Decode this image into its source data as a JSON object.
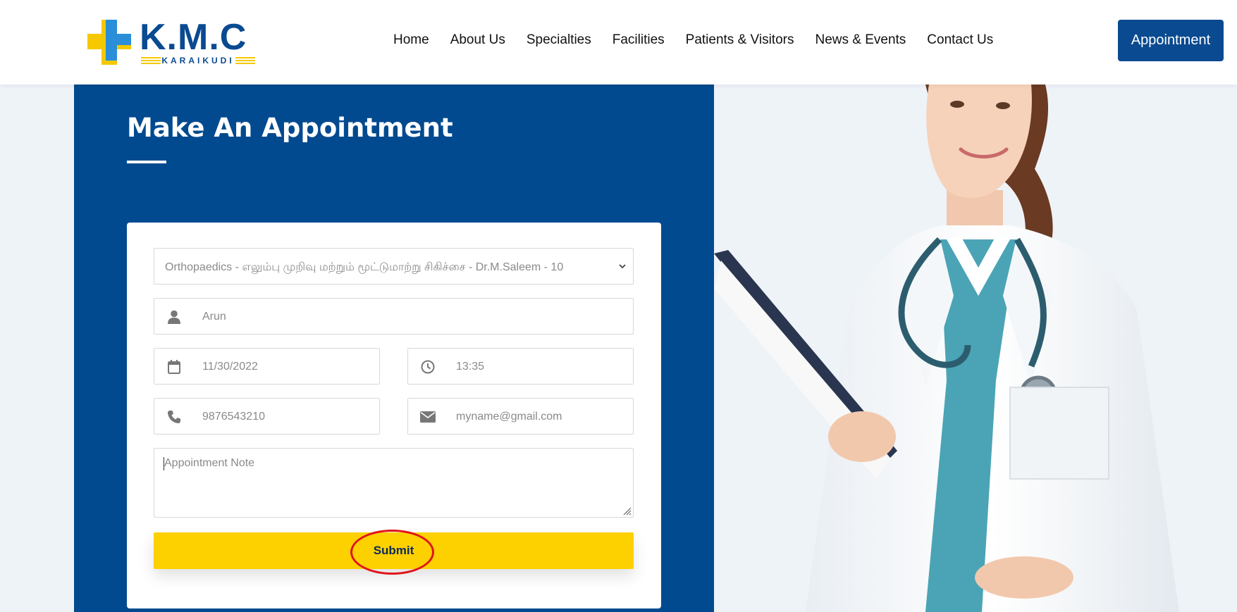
{
  "header": {
    "logo_text": "K.M.C",
    "logo_sub": "KARAIKUDI",
    "nav": [
      "Home",
      "About Us",
      "Specialties",
      "Facilities",
      "Patients & Visitors",
      "News & Events",
      "Contact Us"
    ],
    "appointment_button": "Appointment"
  },
  "main": {
    "title": "Make An Appointment",
    "form": {
      "department_selected": "Orthopaedics - எலும்பு முறிவு மற்றும் மூட்டுமாற்று சிகிச்சை - Dr.M.Saleem - 10",
      "name": "Arun",
      "date": "11/30/2022",
      "time": "13:35",
      "phone": "9876543210",
      "email": "myname@gmail.com",
      "note_placeholder": "Appointment Note",
      "submit_label": "Submit"
    }
  },
  "colors": {
    "brand_blue": "#024a8f",
    "accent_yellow": "#fdd000",
    "highlight_red": "#e0141c"
  },
  "icons": [
    "user-icon",
    "calendar-icon",
    "clock-icon",
    "phone-icon",
    "envelope-icon",
    "chevron-down-icon"
  ]
}
